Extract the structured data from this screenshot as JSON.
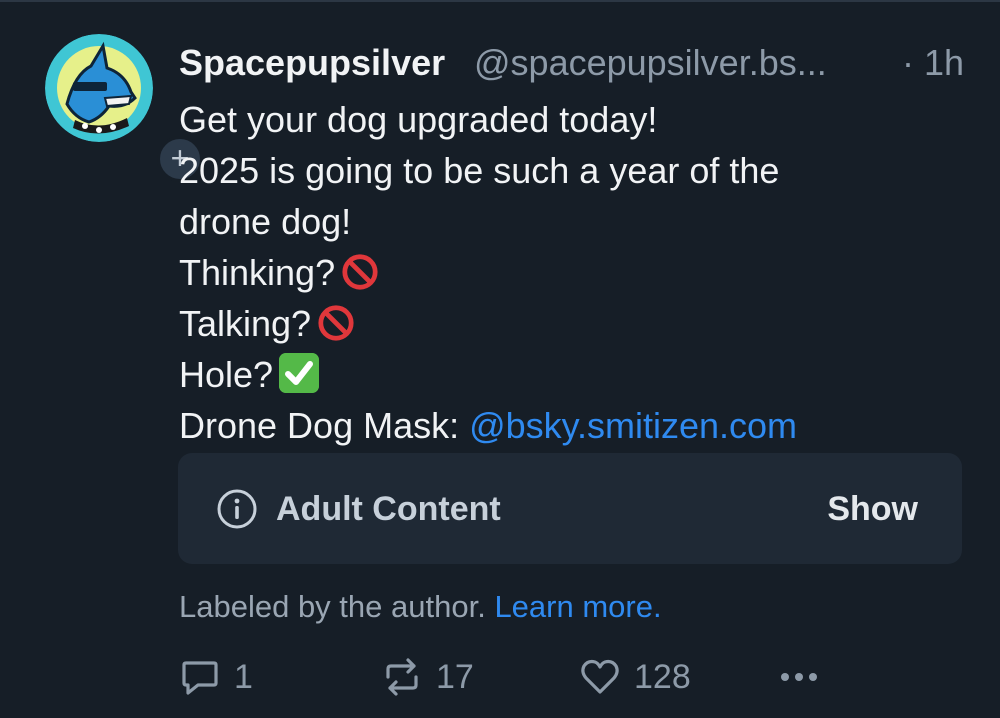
{
  "post": {
    "author": {
      "display_name": "Spacepupsilver",
      "handle": "@spacepupsilver.bs...",
      "follow_label": "+"
    },
    "time": "· 1h",
    "lines": {
      "l1": "Get your dog upgraded today!",
      "l2": "2025 is going to be such a year of the",
      "l3": "drone dog!",
      "l4": "Thinking?",
      "l5": "Talking?",
      "l6": "Hole?",
      "l7_prefix": "Drone Dog Mask: ",
      "l7_link": "@bsky.smitizen.com"
    },
    "emoji": {
      "thinking": "prohibited-icon",
      "talking": "prohibited-icon",
      "hole": "check-mark-button-icon"
    },
    "content_warning": {
      "label": "Adult Content",
      "show_button": "Show",
      "note": "Labeled by the author.",
      "learn_more": "Learn more."
    },
    "stats": {
      "replies": "1",
      "reposts": "17",
      "likes": "128"
    }
  },
  "colors": {
    "background": "#161e27",
    "link": "#2f8af0",
    "muted": "#8d9aa8",
    "card": "#1f2935"
  }
}
